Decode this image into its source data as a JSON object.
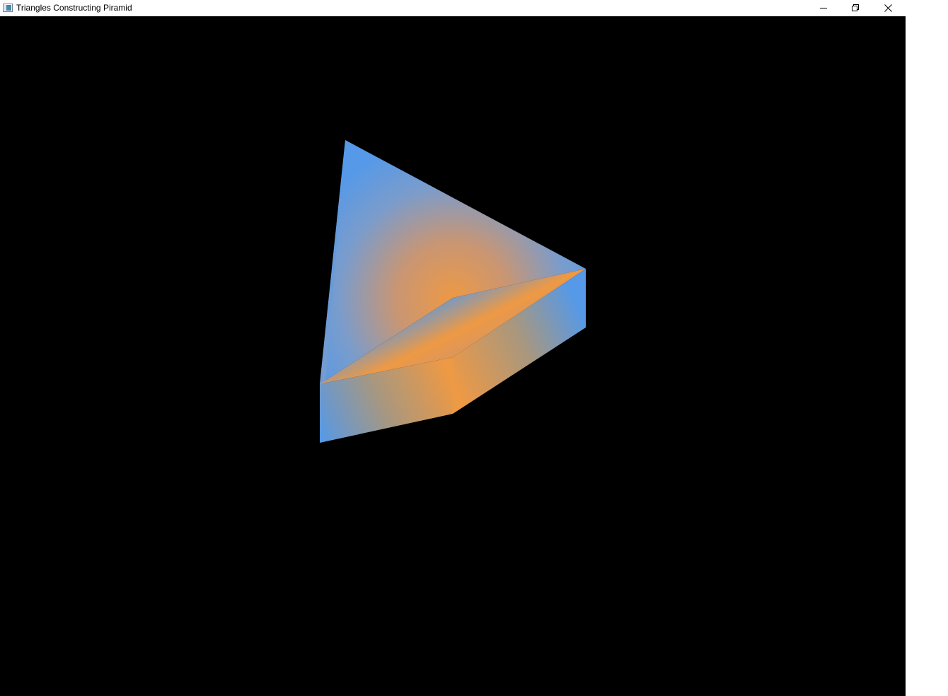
{
  "window": {
    "title": "Triangles Constructing Piramid",
    "controls": {
      "minimize": "minimize-icon",
      "maximize": "restore-icon",
      "close": "close-icon"
    }
  },
  "scene": {
    "background_color": "#000000",
    "colors": {
      "blue": "#5599e8",
      "orange": "#ee9944"
    }
  }
}
